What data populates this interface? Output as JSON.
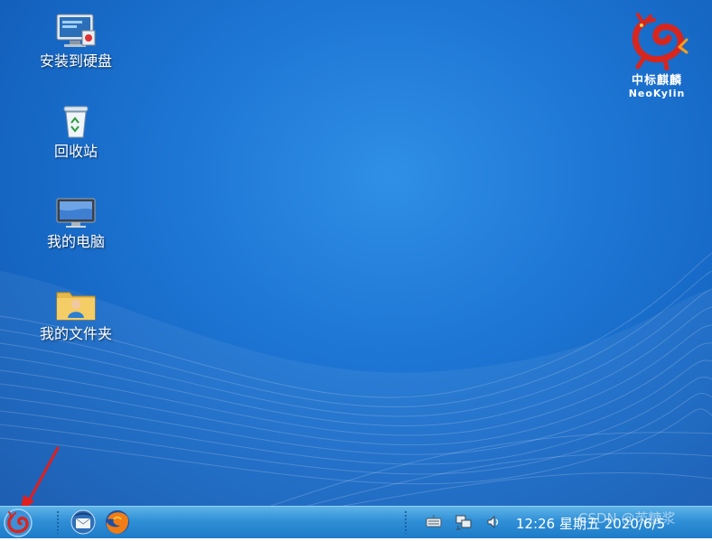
{
  "desktop": {
    "icons": [
      {
        "label": "安装到硬盘",
        "icon": "install-to-disk-icon"
      },
      {
        "label": "回收站",
        "icon": "recycle-bin-icon"
      },
      {
        "label": "我的电脑",
        "icon": "computer-icon"
      },
      {
        "label": "我的文件夹",
        "icon": "user-folder-icon"
      }
    ],
    "logo": {
      "chinese": "中标麒麟",
      "english": "NeoKylin"
    }
  },
  "taskbar": {
    "start_icon": "kylin-start-icon",
    "launchers": [
      {
        "icon": "thunderbird-icon"
      },
      {
        "icon": "firefox-icon"
      }
    ],
    "tray": [
      {
        "icon": "keyboard-icon"
      },
      {
        "icon": "network-icon"
      },
      {
        "icon": "volume-icon"
      }
    ],
    "clock": "12:26 星期五 2020/6/5"
  },
  "watermark": "CSDN @芮糖浆",
  "colors": {
    "desktop": "#1f78d6",
    "taskbar": "#2f8fd6",
    "arrow": "#e01e1e"
  }
}
